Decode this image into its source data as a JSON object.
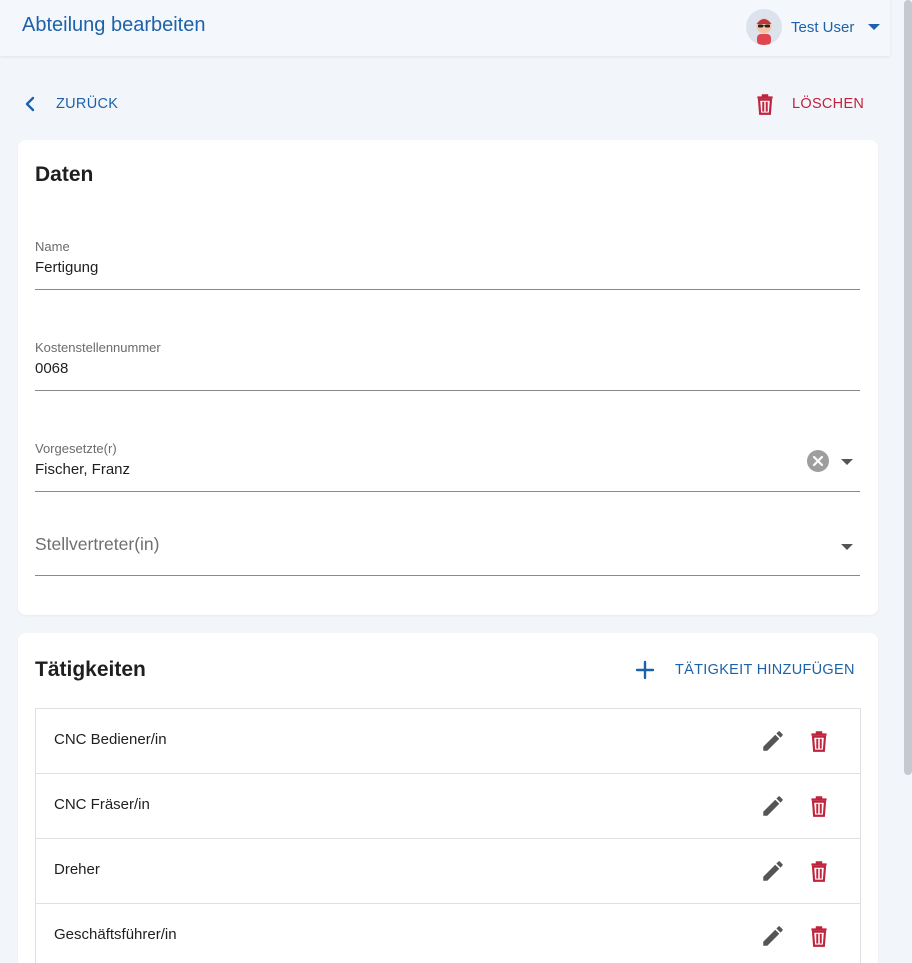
{
  "appbar": {
    "title": "Abteilung bearbeiten",
    "user_name": "Test User"
  },
  "actions": {
    "back_label": "ZURÜCK",
    "delete_label": "LÖSCHEN"
  },
  "data_card": {
    "title": "Daten",
    "fields": {
      "name": {
        "label": "Name",
        "value": "Fertigung"
      },
      "cost_center": {
        "label": "Kostenstellennummer",
        "value": "0068"
      },
      "supervisor": {
        "label": "Vorgesetzte(r)",
        "value": "Fischer, Franz"
      },
      "deputy": {
        "placeholder": "Stellvertreter(in)"
      }
    }
  },
  "tasks_card": {
    "title": "Tätigkeiten",
    "add_label": "TÄTIGKEIT HINZUFÜGEN",
    "items": [
      {
        "label": "CNC Bediener/in"
      },
      {
        "label": "CNC Fräser/in"
      },
      {
        "label": "Dreher"
      },
      {
        "label": "Geschäftsführer/in"
      }
    ]
  },
  "colors": {
    "primary": "#1d62a8",
    "danger": "#c0233c",
    "background": "#f2f6fb"
  },
  "icons": {
    "back": "chevron-left-icon",
    "delete": "trash-icon",
    "add": "plus-icon",
    "edit": "pencil-icon",
    "clear": "clear-circle-icon",
    "dropdown": "caret-down-icon"
  }
}
